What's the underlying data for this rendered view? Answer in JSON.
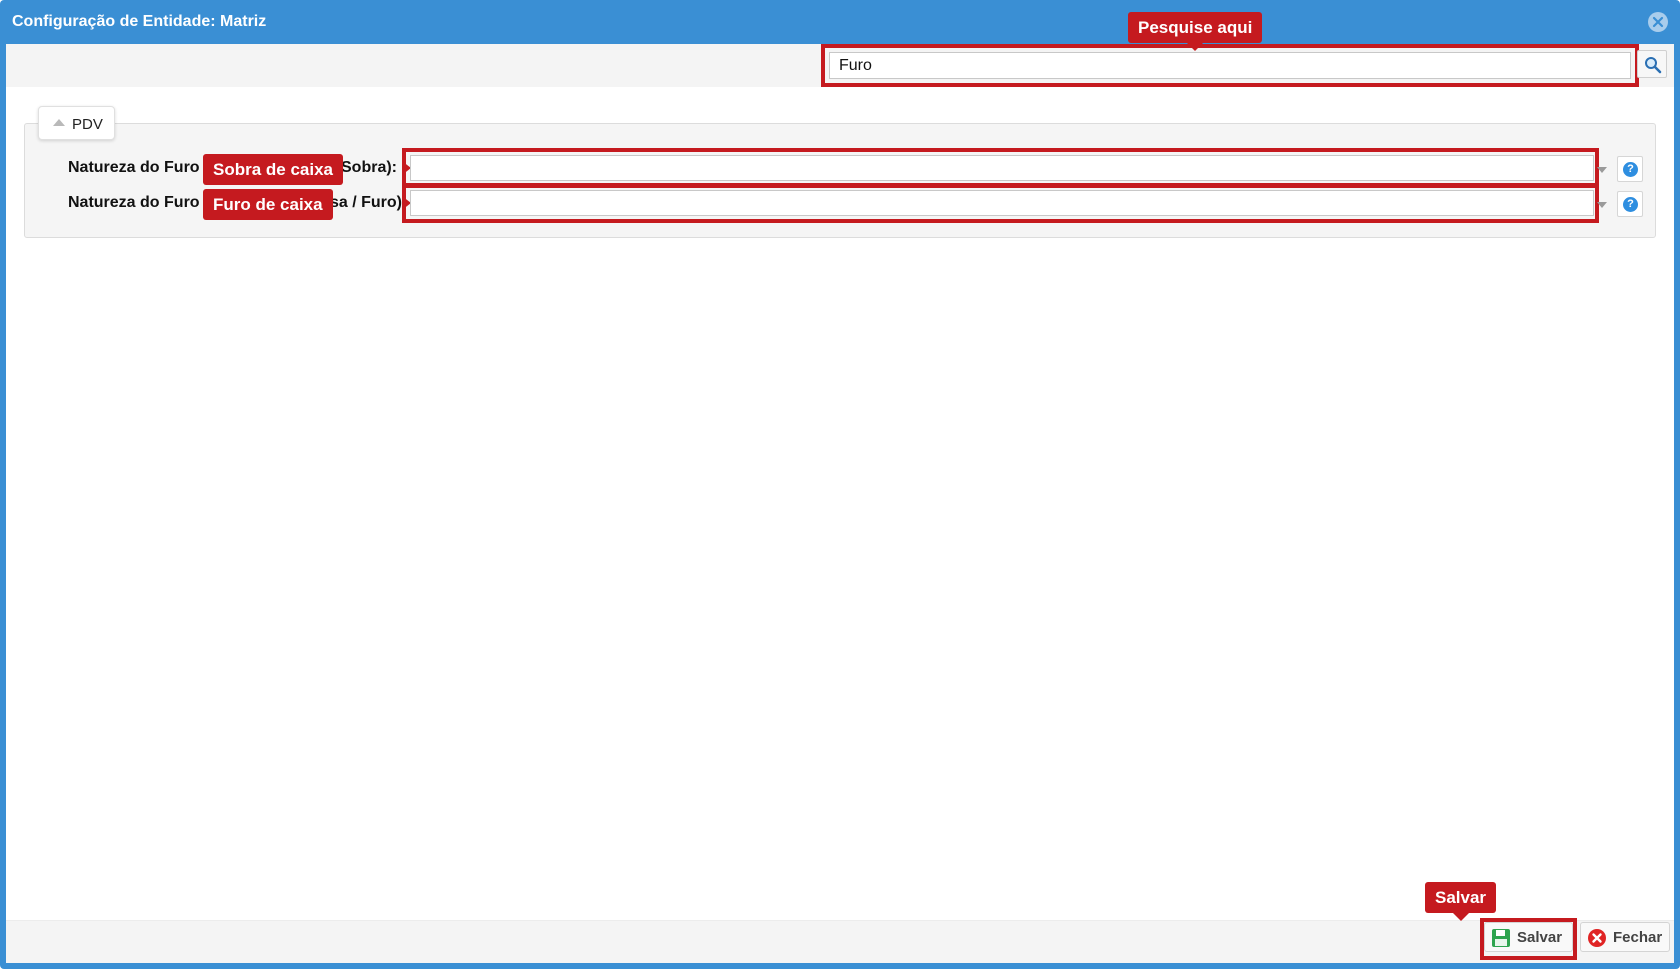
{
  "window": {
    "title": "Configuração de Entidade: Matriz"
  },
  "search": {
    "value": "Furo",
    "placeholder": ""
  },
  "section": {
    "label": "PDV"
  },
  "fields": [
    {
      "label_left": "Natureza do Furo",
      "label_right": "Sobra):",
      "value": ""
    },
    {
      "label_left": "Natureza do Furo",
      "label_right": "sa / Furo):",
      "value": ""
    }
  ],
  "callouts": {
    "search": "Pesquise aqui",
    "field1": "Sobra de caixa",
    "field2": "Furo de caixa",
    "save": "Salvar"
  },
  "buttons": {
    "save": "Salvar",
    "close": "Fechar"
  },
  "colors": {
    "titlebar": "#3a8fd4",
    "annotation": "#c51a1f",
    "help": "#2e8ee0"
  },
  "icons": {
    "close": "close-circle-icon",
    "search": "magnifier-icon",
    "save": "floppy-disk-icon",
    "cancel": "red-x-circle-icon",
    "help": "question-icon"
  }
}
